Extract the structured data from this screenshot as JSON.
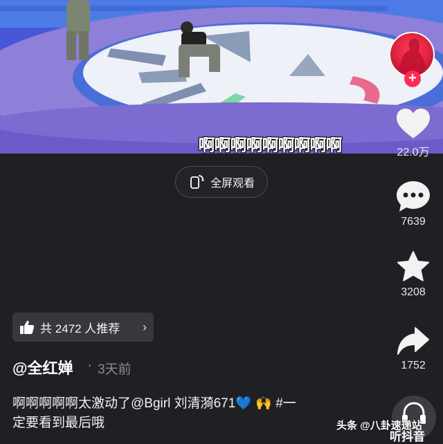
{
  "video": {
    "subtitle": "啊啊啊啊啊啊啊啊啊"
  },
  "fullscreen": {
    "label": "全屏观看",
    "icon": "fullscreen-phone-icon"
  },
  "rail": {
    "follow_icon": "plus-icon",
    "like": {
      "icon": "heart-icon",
      "count": "22.0万"
    },
    "comment": {
      "icon": "comment-icon",
      "count": "7639"
    },
    "favorite": {
      "icon": "star-icon",
      "count": "3208"
    },
    "share": {
      "icon": "share-arrow-icon",
      "count": "1752"
    },
    "listen": {
      "icon": "headphones-icon",
      "label": "听抖音"
    }
  },
  "recommend": {
    "icon": "thumbs-up-icon",
    "label": "共 2472 人推荐",
    "chevron": "›"
  },
  "author": {
    "name": "@全红婵",
    "separator": "·",
    "time": "3天前"
  },
  "description": {
    "line1_text": "啊啊啊啊啊太激动了@Bgirl 刘清漪671",
    "emoji_heart": "💙",
    "emoji_hands": "🙌",
    "line1_tag": "#一",
    "line2": "定要看到最后哦"
  },
  "watermark": "头条 @八卦速递站",
  "colors": {
    "background": "#1f2024",
    "accent_red": "#fe2c55",
    "heart_blue": "#2f86f2"
  }
}
